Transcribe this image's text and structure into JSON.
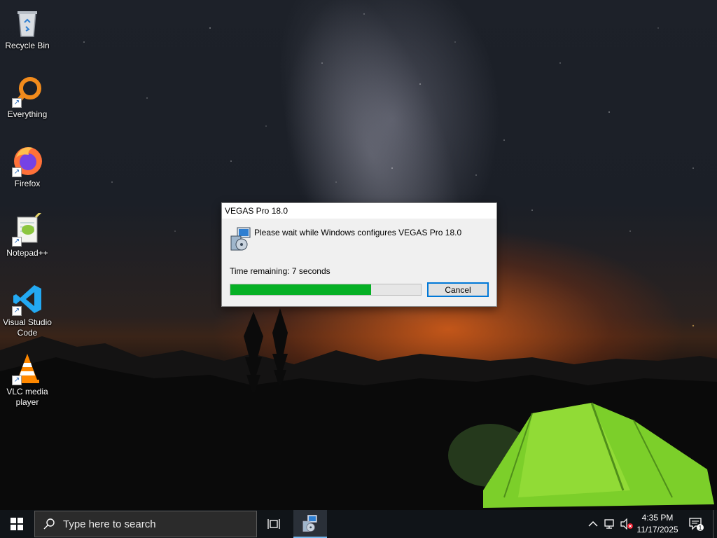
{
  "desktop": {
    "icons": [
      {
        "label": "Recycle Bin",
        "icon": "recycle-bin-icon"
      },
      {
        "label": "Everything",
        "icon": "everything-search-icon"
      },
      {
        "label": "Firefox",
        "icon": "firefox-icon"
      },
      {
        "label": "Notepad++",
        "icon": "notepadpp-icon"
      },
      {
        "label": "Visual Studio Code",
        "icon": "vscode-icon"
      },
      {
        "label": "VLC media player",
        "icon": "vlc-icon"
      }
    ]
  },
  "dialog": {
    "title": "VEGAS Pro 18.0",
    "message": "Please wait while Windows configures VEGAS Pro 18.0",
    "time_remaining": "Time remaining: 7 seconds",
    "progress_percent": 74,
    "cancel_label": "Cancel",
    "icon": "installer-icon"
  },
  "taskbar": {
    "search_placeholder": "Type here to search",
    "active_app_icon": "installer-icon",
    "clock_time": "4:35 PM",
    "clock_date": "11/17/2025",
    "notification_count": "1",
    "accent_color": "#0078d7",
    "progress_color": "#06b025"
  }
}
